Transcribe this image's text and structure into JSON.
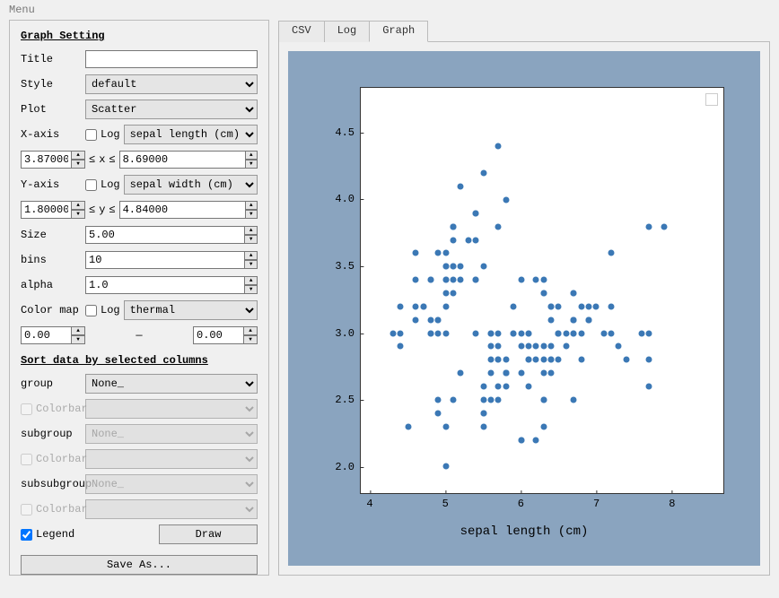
{
  "menu": {
    "label": "Menu"
  },
  "settings": {
    "section_title": "Graph Setting",
    "title_label": "Title",
    "title_value": "",
    "style_label": "Style",
    "style_value": "default",
    "plot_label": "Plot",
    "plot_value": "Scatter",
    "xaxis_label": "X-axis",
    "x_log_label": "Log",
    "x_field": "sepal length (cm)",
    "x_min": "3.87000",
    "x_max": "8.69000",
    "x_sym": "x",
    "le": "≤",
    "yaxis_label": "Y-axis",
    "y_log_label": "Log",
    "y_field": "sepal width (cm)",
    "y_min": "1.80000",
    "y_max": "4.84000",
    "y_sym": "y",
    "size_label": "Size",
    "size_value": "5.00",
    "bins_label": "bins",
    "bins_value": "10",
    "alpha_label": "alpha",
    "alpha_value": "1.0",
    "cmap_label": "Color map",
    "cmap_log_label": "Log",
    "cmap_value": "thermal",
    "cmap_min": "0.00",
    "cmap_dash": "—",
    "cmap_max": "0.00"
  },
  "sort": {
    "section_title": "Sort data by selected columns",
    "group_label": "group",
    "group_value": "None_",
    "colorbar_label": "Colorbar",
    "subgroup_label": "subgroup",
    "subgroup_value": "None_",
    "subsubgroup_label": "subsubgroup",
    "subsubgroup_value": "None_",
    "legend_label": "Legend",
    "draw_label": "Draw",
    "saveas_label": "Save As..."
  },
  "tabs": {
    "csv": "CSV",
    "log": "Log",
    "graph": "Graph"
  },
  "chart": {
    "xlabel": "sepal length (cm)",
    "ylabel": "sepal width (cm)",
    "x_ticks": [
      4,
      5,
      6,
      7,
      8
    ],
    "y_ticks": [
      2.0,
      2.5,
      3.0,
      3.5,
      4.0,
      4.5
    ]
  },
  "chart_data": {
    "type": "scatter",
    "xlabel": "sepal length (cm)",
    "ylabel": "sepal width (cm)",
    "xlim": [
      3.87,
      8.69
    ],
    "ylim": [
      1.8,
      4.84
    ],
    "series": [
      {
        "name": "",
        "points": [
          [
            5.1,
            3.5
          ],
          [
            4.9,
            3.0
          ],
          [
            4.7,
            3.2
          ],
          [
            4.6,
            3.1
          ],
          [
            5.0,
            3.6
          ],
          [
            5.4,
            3.9
          ],
          [
            4.6,
            3.4
          ],
          [
            5.0,
            3.4
          ],
          [
            4.4,
            2.9
          ],
          [
            4.9,
            3.1
          ],
          [
            5.4,
            3.7
          ],
          [
            4.8,
            3.4
          ],
          [
            4.8,
            3.0
          ],
          [
            4.3,
            3.0
          ],
          [
            5.8,
            4.0
          ],
          [
            5.7,
            4.4
          ],
          [
            5.4,
            3.9
          ],
          [
            5.1,
            3.5
          ],
          [
            5.7,
            3.8
          ],
          [
            5.1,
            3.8
          ],
          [
            5.4,
            3.4
          ],
          [
            5.1,
            3.7
          ],
          [
            4.6,
            3.6
          ],
          [
            5.1,
            3.3
          ],
          [
            4.8,
            3.4
          ],
          [
            5.0,
            3.0
          ],
          [
            5.0,
            3.4
          ],
          [
            5.2,
            3.5
          ],
          [
            5.2,
            3.4
          ],
          [
            4.7,
            3.2
          ],
          [
            4.8,
            3.1
          ],
          [
            5.4,
            3.4
          ],
          [
            5.2,
            4.1
          ],
          [
            5.5,
            4.2
          ],
          [
            4.9,
            3.1
          ],
          [
            5.0,
            3.2
          ],
          [
            5.5,
            3.5
          ],
          [
            4.9,
            3.6
          ],
          [
            4.4,
            3.0
          ],
          [
            5.1,
            3.4
          ],
          [
            5.0,
            3.5
          ],
          [
            4.5,
            2.3
          ],
          [
            4.4,
            3.2
          ],
          [
            5.0,
            3.5
          ],
          [
            5.1,
            3.8
          ],
          [
            4.8,
            3.0
          ],
          [
            5.1,
            3.8
          ],
          [
            4.6,
            3.2
          ],
          [
            5.3,
            3.7
          ],
          [
            5.0,
            3.3
          ],
          [
            7.0,
            3.2
          ],
          [
            6.4,
            3.2
          ],
          [
            6.9,
            3.1
          ],
          [
            5.5,
            2.3
          ],
          [
            6.5,
            2.8
          ],
          [
            5.7,
            2.8
          ],
          [
            6.3,
            3.3
          ],
          [
            4.9,
            2.4
          ],
          [
            6.6,
            2.9
          ],
          [
            5.2,
            2.7
          ],
          [
            5.0,
            2.0
          ],
          [
            5.9,
            3.0
          ],
          [
            6.0,
            2.2
          ],
          [
            6.1,
            2.9
          ],
          [
            5.6,
            2.9
          ],
          [
            6.7,
            3.1
          ],
          [
            5.6,
            3.0
          ],
          [
            5.8,
            2.7
          ],
          [
            6.2,
            2.2
          ],
          [
            5.6,
            2.5
          ],
          [
            5.9,
            3.2
          ],
          [
            6.1,
            2.8
          ],
          [
            6.3,
            2.5
          ],
          [
            6.1,
            2.8
          ],
          [
            6.4,
            2.9
          ],
          [
            6.6,
            3.0
          ],
          [
            6.8,
            2.8
          ],
          [
            6.7,
            3.0
          ],
          [
            6.0,
            2.9
          ],
          [
            5.7,
            2.6
          ],
          [
            5.5,
            2.4
          ],
          [
            5.5,
            2.4
          ],
          [
            5.8,
            2.7
          ],
          [
            6.0,
            2.7
          ],
          [
            5.4,
            3.0
          ],
          [
            6.0,
            3.4
          ],
          [
            6.7,
            3.1
          ],
          [
            6.3,
            2.3
          ],
          [
            5.6,
            3.0
          ],
          [
            5.5,
            2.5
          ],
          [
            5.5,
            2.6
          ],
          [
            6.1,
            3.0
          ],
          [
            5.8,
            2.6
          ],
          [
            5.0,
            2.3
          ],
          [
            5.6,
            2.7
          ],
          [
            5.7,
            3.0
          ],
          [
            5.7,
            2.9
          ],
          [
            6.2,
            2.9
          ],
          [
            5.1,
            2.5
          ],
          [
            5.7,
            2.8
          ],
          [
            6.3,
            3.3
          ],
          [
            5.8,
            2.7
          ],
          [
            7.1,
            3.0
          ],
          [
            6.3,
            2.9
          ],
          [
            6.5,
            3.0
          ],
          [
            7.6,
            3.0
          ],
          [
            4.9,
            2.5
          ],
          [
            7.3,
            2.9
          ],
          [
            6.7,
            2.5
          ],
          [
            7.2,
            3.6
          ],
          [
            6.5,
            3.2
          ],
          [
            6.4,
            2.7
          ],
          [
            6.8,
            3.0
          ],
          [
            5.7,
            2.5
          ],
          [
            5.8,
            2.8
          ],
          [
            6.4,
            3.2
          ],
          [
            6.5,
            3.0
          ],
          [
            7.7,
            3.8
          ],
          [
            7.7,
            2.6
          ],
          [
            6.0,
            2.2
          ],
          [
            6.9,
            3.2
          ],
          [
            5.6,
            2.8
          ],
          [
            7.7,
            2.8
          ],
          [
            6.3,
            2.7
          ],
          [
            6.7,
            3.3
          ],
          [
            7.2,
            3.2
          ],
          [
            6.2,
            2.8
          ],
          [
            6.1,
            3.0
          ],
          [
            6.4,
            2.8
          ],
          [
            7.2,
            3.0
          ],
          [
            7.4,
            2.8
          ],
          [
            7.9,
            3.8
          ],
          [
            6.4,
            2.8
          ],
          [
            6.3,
            2.8
          ],
          [
            6.1,
            2.6
          ],
          [
            7.7,
            3.0
          ],
          [
            6.3,
            3.4
          ],
          [
            6.4,
            3.1
          ],
          [
            6.0,
            3.0
          ],
          [
            6.9,
            3.1
          ],
          [
            6.7,
            3.1
          ],
          [
            6.9,
            3.1
          ],
          [
            5.8,
            2.7
          ],
          [
            6.8,
            3.2
          ],
          [
            6.7,
            3.3
          ],
          [
            6.7,
            3.0
          ],
          [
            6.3,
            2.5
          ],
          [
            6.5,
            3.0
          ],
          [
            6.2,
            3.4
          ],
          [
            5.9,
            3.0
          ]
        ]
      }
    ]
  }
}
